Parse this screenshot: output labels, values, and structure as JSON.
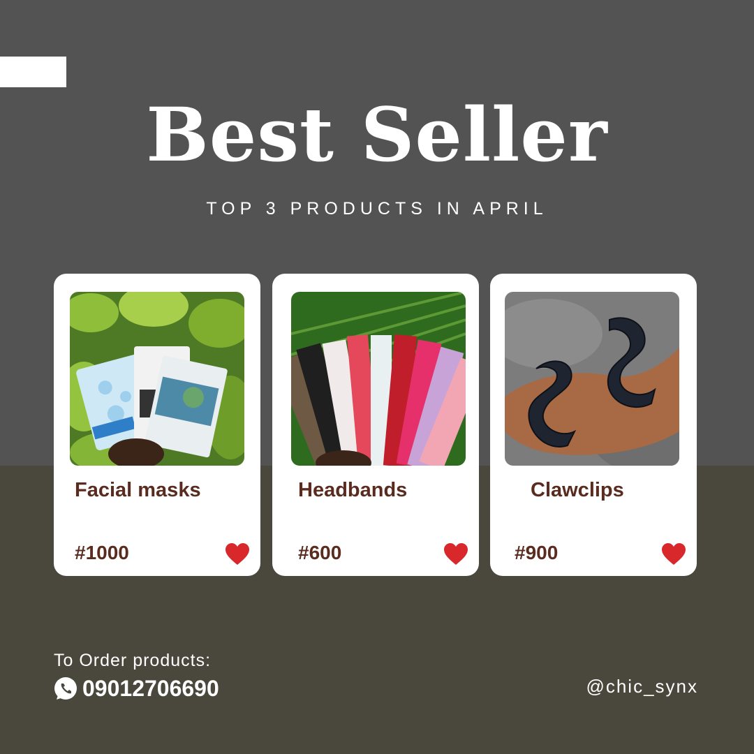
{
  "header": {
    "title": "Best Seller",
    "subtitle": "TOP 3 PRODUCTS IN APRIL"
  },
  "products": [
    {
      "name": "Facial masks",
      "price": "#1000",
      "image_icon": "facial-masks-photo"
    },
    {
      "name": "Headbands",
      "price": "#600",
      "image_icon": "headbands-photo"
    },
    {
      "name": "Clawclips",
      "price": "#900",
      "image_icon": "clawclips-photo"
    }
  ],
  "footer": {
    "order_label": "To Order products:",
    "phone": "09012706690",
    "handle": "@chic_synx"
  },
  "colors": {
    "top_background": "#535353",
    "bottom_background": "#4a483c",
    "card_background": "#ffffff",
    "text_brown": "#5a2b1f",
    "heart_red": "#d8282c"
  }
}
